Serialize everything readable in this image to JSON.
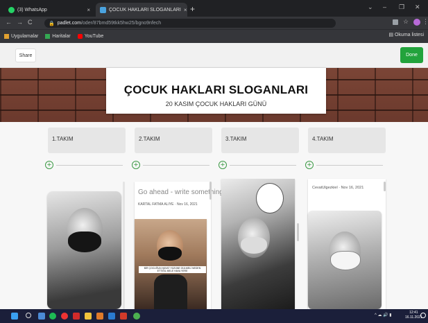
{
  "browser": {
    "tabs": [
      {
        "label": "(3) WhatsApp",
        "close": "×"
      },
      {
        "label": "ÇOCUK HAKLARI SLOGANLARI",
        "close": "×"
      }
    ],
    "new_tab": "+",
    "window_controls": [
      "⌄",
      "–",
      "❐",
      "✕"
    ],
    "nav": [
      "←",
      "→",
      "C"
    ],
    "url_host": "padlet.com",
    "url_path": "/oder/87bmd59tkk5hw25/bgno9nfech",
    "bookmarks": [
      "Uygulamalar",
      "Haritalar",
      "YouTube"
    ],
    "reading_list": "Okuma listesi"
  },
  "padlet": {
    "share_label": "Share",
    "done_label": "Done",
    "title": "ÇOCUK HAKLARI SLOGANLARI",
    "subtitle": "20 KASIM ÇOCUK HAKLARI GÜNÜ",
    "columns": [
      {
        "title": "1.TAKIM"
      },
      {
        "title": "2.TAKIM"
      },
      {
        "title": "3.TAKIM"
      },
      {
        "title": "4.TAKIM"
      }
    ],
    "add_icon": "+",
    "post2": {
      "prompt": "Go ahead - write something",
      "author": "KARTAL FATMA ALIYE   ·  Nov 16, 2021",
      "caption": "BİR ÇOCUĞUN HAYAT YÜZÜNE GÜLMELİ NEDEN ETTİĞİL MELE HAVA YERE"
    },
    "post4": {
      "author": "CevatUlgezkiel  ·  Nov 16, 2021"
    }
  },
  "taskbar": {
    "time": "12:41",
    "date": "16.11.2021"
  },
  "colors": {
    "done": "#22a33c",
    "plus": "#3c9a45",
    "taskbar": "#1b1f3a"
  }
}
